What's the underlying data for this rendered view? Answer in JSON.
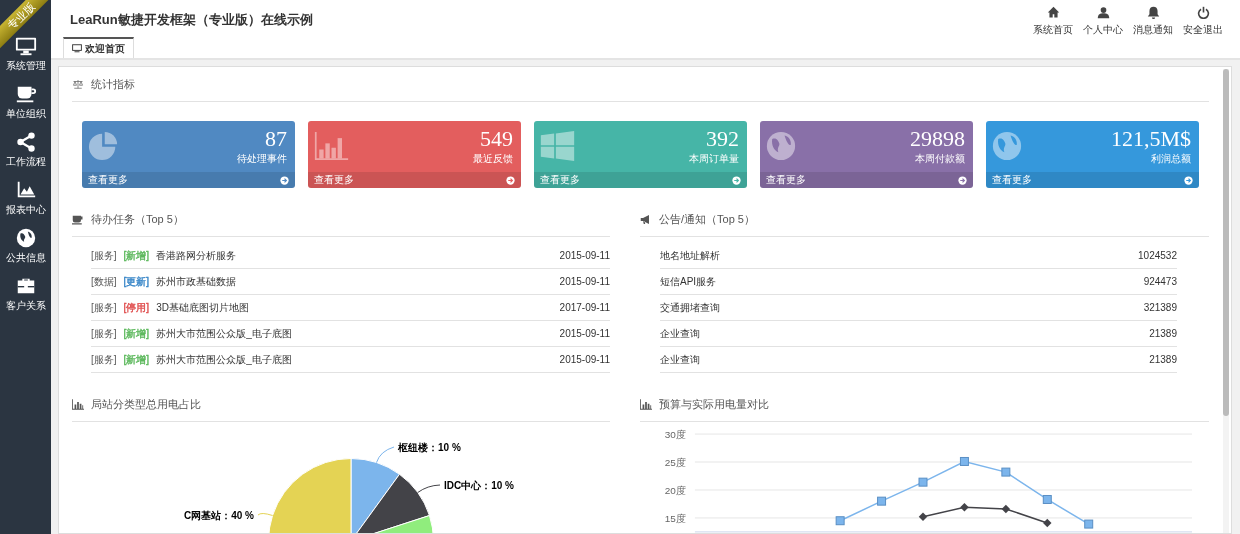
{
  "ribbon": "专业版",
  "sidebar": {
    "items": [
      {
        "label": "系统管理",
        "kind": "monitor"
      },
      {
        "label": "单位组织",
        "kind": "cup"
      },
      {
        "label": "工作流程",
        "kind": "share"
      },
      {
        "label": "报表中心",
        "kind": "area"
      },
      {
        "label": "公共信息",
        "kind": "globe"
      },
      {
        "label": "客户关系",
        "kind": "briefcase"
      }
    ]
  },
  "title": "LeaRun敏捷开发框架（专业版）在线示例",
  "top_nav": [
    {
      "label": "系统首页",
      "kind": "home"
    },
    {
      "label": "个人中心",
      "kind": "user"
    },
    {
      "label": "消息通知",
      "kind": "bell"
    },
    {
      "label": "安全退出",
      "kind": "power"
    }
  ],
  "tabs": [
    {
      "label": "欢迎首页",
      "selected": true
    }
  ],
  "stats": {
    "title": "统计指标",
    "cards": [
      {
        "value": "87",
        "label": "待处理事件",
        "more": "查看更多",
        "color": "#5089c2",
        "kind": "pie"
      },
      {
        "value": "549",
        "label": "最近反馈",
        "more": "查看更多",
        "color": "#e35e5e",
        "kind": "bars"
      },
      {
        "value": "392",
        "label": "本周订单量",
        "more": "查看更多",
        "color": "#46b5a7",
        "kind": "windows"
      },
      {
        "value": "29898",
        "label": "本周付款额",
        "more": "查看更多",
        "color": "#8970a8",
        "kind": "globe"
      },
      {
        "value": "121,5M$",
        "label": "利润总额",
        "more": "查看更多",
        "color": "#3598dc",
        "kind": "globe"
      }
    ]
  },
  "tasks": {
    "title": "待办任务（Top 5）",
    "rows": [
      {
        "type": "[服务]",
        "tag": "[新增]",
        "color": "#5cb85c",
        "name": "香港路网分析服务",
        "date": "2015-09-11"
      },
      {
        "type": "[数据]",
        "tag": "[更新]",
        "color": "#3a87c8",
        "name": "苏州市政基础数据",
        "date": "2015-09-11"
      },
      {
        "type": "[服务]",
        "tag": "[停用]",
        "color": "#e05050",
        "name": "3D基础底图切片地图",
        "date": "2017-09-11"
      },
      {
        "type": "[服务]",
        "tag": "[新增]",
        "color": "#5cb85c",
        "name": "苏州大市范围公众版_电子底图",
        "date": "2015-09-11"
      },
      {
        "type": "[服务]",
        "tag": "[新增]",
        "color": "#5cb85c",
        "name": "苏州大市范围公众版_电子底图",
        "date": "2015-09-11"
      }
    ]
  },
  "notices": {
    "title": "公告/通知（Top 5）",
    "rows": [
      {
        "name": "地名地址解析",
        "count": "1024532"
      },
      {
        "name": "短信API服务",
        "count": "924473"
      },
      {
        "name": "交通拥堵查询",
        "count": "321389"
      },
      {
        "name": "企业查询",
        "count": "21389"
      },
      {
        "name": "企业查询",
        "count": "21389"
      }
    ]
  },
  "pie_panel": {
    "title": "局站分类型总用电占比",
    "chart_data": {
      "type": "pie",
      "values": [
        10,
        10,
        40,
        40
      ],
      "value_labels": [
        "枢纽楼：10 %",
        "IDC中心：10 %",
        null,
        "C网基站：40 %"
      ]
    }
  },
  "line_panel": {
    "title": "预算与实际用电量对比",
    "chart_data": {
      "type": "line",
      "ylim": [
        12.5,
        30
      ],
      "grid": true,
      "yticks": [
        {
          "value": 15,
          "label": "15度"
        },
        {
          "value": 20,
          "label": "20度"
        },
        {
          "value": 25,
          "label": "25度"
        },
        {
          "value": 30,
          "label": "30度"
        }
      ],
      "series": [
        {
          "color": "#7cb5ec",
          "marker": "square",
          "values": [
            null,
            null,
            null,
            14.5,
            18.0,
            21.4,
            25.1,
            23.2,
            18.3,
            13.9,
            null,
            null
          ]
        },
        {
          "color": "#434348",
          "marker": "diamond",
          "values": [
            null,
            null,
            null,
            null,
            null,
            15.2,
            16.9,
            16.6,
            14.1,
            null,
            null,
            null
          ]
        }
      ]
    }
  }
}
